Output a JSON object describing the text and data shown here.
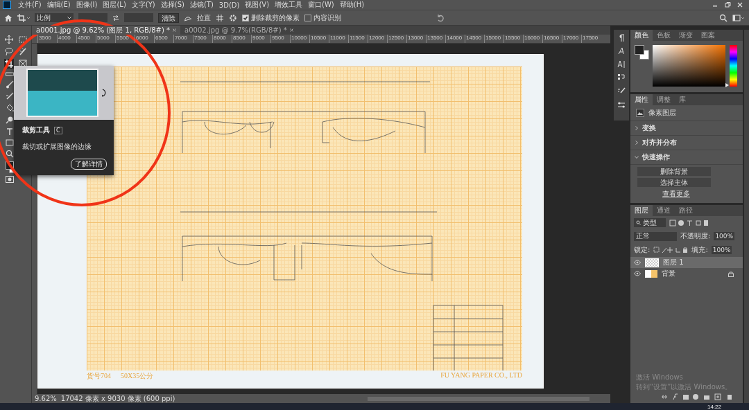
{
  "menu_bar": {
    "items": [
      "文件(F)",
      "编辑(E)",
      "图像(I)",
      "图层(L)",
      "文字(Y)",
      "选择(S)",
      "滤镜(T)",
      "3D(D)",
      "视图(V)",
      "增效工具",
      "窗口(W)",
      "帮助(H)"
    ]
  },
  "options_bar": {
    "ratio_select": "比例",
    "clear_button": "清除",
    "straighten_button": "拉直",
    "options": [
      {
        "label": "删除裁剪的像素",
        "checked": true
      },
      {
        "label": "内容识别",
        "checked": false
      }
    ]
  },
  "document_tabs": [
    {
      "label": "a0001.jpg @ 9.62% (图层 1, RGB/8#) *",
      "selected": true
    },
    {
      "label": "a0002.jpg @ 9.7%(RGB/8#) *",
      "selected": false
    }
  ],
  "ruler_ticks": [
    "3500",
    "4000",
    "4500",
    "5000",
    "5500",
    "6000",
    "6500",
    "7000",
    "7500",
    "8000",
    "8500",
    "9000",
    "9500",
    "10000",
    "10500",
    "11000",
    "11500",
    "12000",
    "12500",
    "13000",
    "13500",
    "14000",
    "14500",
    "15000",
    "15500",
    "16000",
    "16500",
    "17000",
    "17500"
  ],
  "tooltip": {
    "title": "裁剪工具",
    "shortcut": "C",
    "description": "裁切或扩展图像的边缘",
    "learn_more": "了解详情"
  },
  "document": {
    "footer_left": [
      "货号704",
      "50X35公分"
    ],
    "footer_right": "FU YANG PAPER CO., LTD"
  },
  "color_panel": {
    "hue_slider": {
      "level": 0.03
    },
    "tabs": [
      {
        "label": "颜色",
        "selected": true
      },
      {
        "label": "色板",
        "selected": false
      },
      {
        "label": "渐变",
        "selected": false
      },
      {
        "label": "图案",
        "selected": false
      }
    ]
  },
  "properties_panel": {
    "tabs": [
      {
        "label": "属性",
        "selected": true
      },
      {
        "label": "调整",
        "selected": false
      },
      {
        "label": "库",
        "selected": false
      }
    ],
    "layer_type": "像素图层",
    "sections": [
      {
        "label": "变换",
        "expanded": false
      },
      {
        "label": "对齐并分布",
        "expanded": false
      },
      {
        "label": "快速操作",
        "expanded": true
      }
    ],
    "quick_actions": [
      "删除背景",
      "选择主体"
    ],
    "more_link": "查看更多"
  },
  "layers_panel": {
    "tabs": [
      {
        "label": "图层",
        "selected": true
      },
      {
        "label": "通道",
        "selected": false
      },
      {
        "label": "路径",
        "selected": false
      }
    ],
    "filter": "类型",
    "blend_mode": "正常",
    "opacity_label": "不透明度:",
    "opacity": "100%",
    "lock_label": "锁定:",
    "fill_label": "填充:",
    "fill": "100%",
    "layers": [
      {
        "name": "图层 1",
        "selected": true,
        "locked": false
      },
      {
        "name": "背景",
        "selected": false,
        "locked": true
      }
    ]
  },
  "status_bar": {
    "zoom": "9.62%",
    "doc_info": "17042 像素 x 9030 像素 (600 ppi)"
  },
  "windows_notice": {
    "title": "激活 Windows",
    "hint": "转到“设置”以激活 Windows。"
  },
  "taskbar": {
    "time": "14:22"
  }
}
